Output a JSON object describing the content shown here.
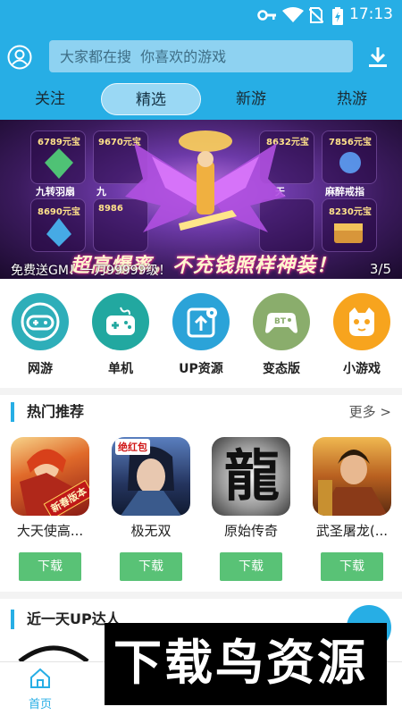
{
  "status_bar": {
    "time": "17:13",
    "icons": [
      "key-icon",
      "wifi-icon",
      "no-sim-icon",
      "battery-charging-icon"
    ]
  },
  "header": {
    "search_placeholder": "大家都在搜  你喜欢的游戏",
    "tabs": [
      {
        "label": "关注",
        "active": false
      },
      {
        "label": "精选",
        "active": true
      },
      {
        "label": "新游",
        "active": false
      },
      {
        "label": "热游",
        "active": false
      }
    ]
  },
  "banner": {
    "headline": "超高爆率，不充钱照样神装！",
    "caption": "免费送GM！一刀99999级！",
    "pager": "3/5",
    "prices": [
      "6789元宝",
      "9670元宝",
      "8632元宝",
      "7856元宝",
      "8690元宝",
      "8986",
      "8230元宝"
    ],
    "gifts": [
      "九转羽扇",
      "九",
      "天",
      "麻醉戒指"
    ]
  },
  "categories": [
    {
      "label": "网游",
      "icon": "gamepad-icon",
      "color": "#2eaeb9"
    },
    {
      "label": "单机",
      "icon": "console-icon",
      "color": "#22a8a0"
    },
    {
      "label": "UP资源",
      "icon": "share-upload-icon",
      "color": "#2ba3d8"
    },
    {
      "label": "变态版",
      "icon": "bt-gamepad-icon",
      "color": "#8aad6c"
    },
    {
      "label": "小游戏",
      "icon": "cat-face-icon",
      "color": "#f7a41e"
    }
  ],
  "hot": {
    "title": "热门推荐",
    "more": "更多 >",
    "games": [
      {
        "name": "大天使高...",
        "button": "下载",
        "badge": "新春版本"
      },
      {
        "name": "极无双",
        "button": "下载",
        "badge": "绝红包"
      },
      {
        "name": "原始传奇",
        "button": "下载",
        "badge": "龍"
      },
      {
        "name": "武圣屠龙(...",
        "button": "下载",
        "badge": ""
      }
    ]
  },
  "up": {
    "title": "近一天UP达人"
  },
  "nav": {
    "home": "首页"
  },
  "watermark": {
    "text": "下载鸟资源"
  },
  "colors": {
    "primary": "#27aee5",
    "download_btn": "#59c276"
  }
}
